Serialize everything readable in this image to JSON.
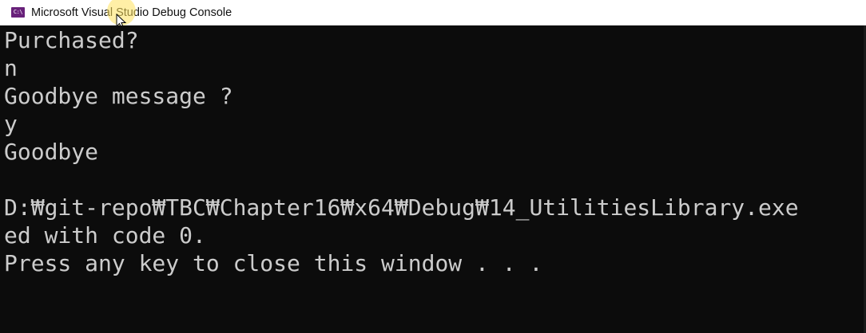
{
  "window": {
    "title": "Microsoft Visual Studio Debug Console",
    "icon": "visual-studio-console-icon",
    "icon_glyph": "C:\\"
  },
  "console": {
    "lines": [
      "Purchased?",
      "n",
      "Goodbye message ?",
      "y",
      "Goodbye",
      "",
      "D:₩git-repo₩TBC₩Chapter16₩x64₩Debug₩14_UtilitiesLibrary.exe",
      "ed with code 0.",
      "Press any key to close this window . . ."
    ],
    "text_color": "#cccccc",
    "background": "#0c0c0c"
  },
  "colors": {
    "titlebar": "#ffffff",
    "icon_accent": "#68217a",
    "cursor_highlight": "#ffe25c"
  }
}
